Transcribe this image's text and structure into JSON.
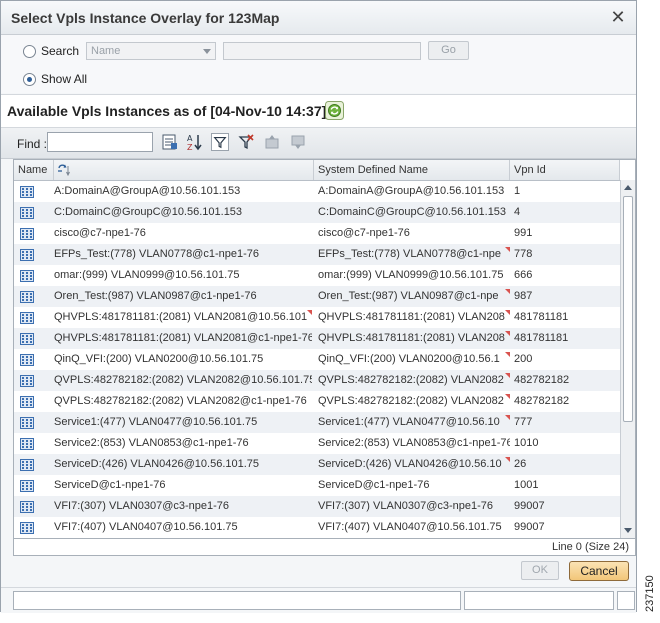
{
  "dialog": {
    "title": "Select Vpls Instance Overlay for 123Map"
  },
  "search": {
    "search_label": "Search",
    "show_all_label": "Show All",
    "field_select_value": "Name",
    "go_label": "Go",
    "selected_option": "Show All"
  },
  "heading": {
    "text": "Available Vpls Instances as of [04-Nov-10 14:37]"
  },
  "toolbar": {
    "find_label": "Find :",
    "find_value": ""
  },
  "table": {
    "columns": [
      "Name",
      "System Defined Name",
      "Vpn Id"
    ],
    "rows": [
      {
        "name": "A:DomainA@GroupA@10.56.101.153",
        "system": "A:DomainA@GroupA@10.56.101.153",
        "vpn": "1"
      },
      {
        "name": "C:DomainC@GroupC@10.56.101.153",
        "system": "C:DomainC@GroupC@10.56.101.153",
        "vpn": "4"
      },
      {
        "name": "cisco@c7-npe1-76",
        "system": "cisco@c7-npe1-76",
        "vpn": "991"
      },
      {
        "name": "EFPs_Test:(778) VLAN0778@c1-npe1-76",
        "system": "EFPs_Test:(778) VLAN0778@c1-npe...",
        "vpn": "778"
      },
      {
        "name": "omar:(999) VLAN0999@10.56.101.75",
        "system": "omar:(999) VLAN0999@10.56.101.75",
        "vpn": "666"
      },
      {
        "name": "Oren_Test:(987) VLAN0987@c1-npe1-76",
        "system": "Oren_Test:(987) VLAN0987@c1-npe...",
        "vpn": "987"
      },
      {
        "name": "QHVPLS:481781181:(2081) VLAN2081@10.56.101...",
        "system": "QHVPLS:481781181:(2081) VLAN208...",
        "vpn": "481781181"
      },
      {
        "name": "QHVPLS:481781181:(2081) VLAN2081@c1-npe1-76",
        "system": "QHVPLS:481781181:(2081) VLAN208...",
        "vpn": "481781181"
      },
      {
        "name": "QinQ_VFI:(200) VLAN0200@10.56.101.75",
        "system": "QinQ_VFI:(200) VLAN0200@10.56.1...",
        "vpn": "200"
      },
      {
        "name": "QVPLS:482782182:(2082) VLAN2082@10.56.101.75",
        "system": "QVPLS:482782182:(2082) VLAN2082...",
        "vpn": "482782182"
      },
      {
        "name": "QVPLS:482782182:(2082) VLAN2082@c1-npe1-76",
        "system": "QVPLS:482782182:(2082) VLAN2082...",
        "vpn": "482782182"
      },
      {
        "name": "Service1:(477) VLAN0477@10.56.101.75",
        "system": "Service1:(477) VLAN0477@10.56.10...",
        "vpn": "777"
      },
      {
        "name": "Service2:(853) VLAN0853@c1-npe1-76",
        "system": "Service2:(853) VLAN0853@c1-npe1-76",
        "vpn": "1010"
      },
      {
        "name": "ServiceD:(426) VLAN0426@10.56.101.75",
        "system": "ServiceD:(426) VLAN0426@10.56.10...",
        "vpn": "26"
      },
      {
        "name": "ServiceD@c1-npe1-76",
        "system": "ServiceD@c1-npe1-76",
        "vpn": "1001"
      },
      {
        "name": "VFI7:(307) VLAN0307@c3-npe1-76",
        "system": "VFI7:(307) VLAN0307@c3-npe1-76",
        "vpn": "99007"
      },
      {
        "name": "VFI7:(407) VLAN0407@10.56.101.75",
        "system": "VFI7:(407) VLAN0407@10.56.101.75",
        "vpn": "99007"
      }
    ]
  },
  "status": {
    "line_info": "Line 0 (Size 24)"
  },
  "buttons": {
    "ok_label": "OK",
    "cancel_label": "Cancel"
  },
  "figure_id": "237150",
  "colors": {
    "accent": "#2f5f98",
    "cancel_button": "#f2c679",
    "truncation_marker": "#d9534f"
  }
}
